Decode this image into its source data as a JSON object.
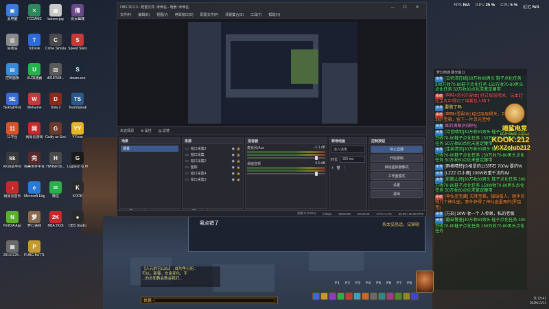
{
  "top_stats": {
    "fps_label": "FPS",
    "fps_value": "N/A",
    "gpu_label": "GPU",
    "gpu_value": "25 %",
    "cpu_label": "CPU",
    "cpu_value": "5 %",
    "latency_label": "延迟",
    "latency_value": "N/A"
  },
  "desktop_icons": [
    {
      "label": "此电脑",
      "glyph": "▣",
      "color": "#3a7bd5"
    },
    {
      "label": "TCGAME",
      "glyph": "✕",
      "color": "#2c8a5a"
    },
    {
      "label": "banner.jpg",
      "glyph": "▦",
      "color": "#c9c9c9"
    },
    {
      "label": "倩女幽魂",
      "glyph": "倩",
      "color": "#6a4a8a"
    },
    {
      "label": "回收站",
      "glyph": "▥",
      "color": "#8a8a8a"
    },
    {
      "label": "ToDesk",
      "glyph": "T",
      "color": "#2b6ad8"
    },
    {
      "label": "Crime Simulator",
      "glyph": "C",
      "color": "#4a4a4a"
    },
    {
      "label": "Speed Stars",
      "glyph": "S",
      "color": "#c43a3a"
    },
    {
      "label": "控制面板",
      "glyph": "▤",
      "color": "#3a8ad5"
    },
    {
      "label": "UU加速器",
      "glyph": "U",
      "color": "#2ab04a"
    },
    {
      "label": "d0187b9f...",
      "glyph": "▧",
      "color": "#5a5a5a"
    },
    {
      "label": "steam.exe",
      "glyph": "S",
      "color": "#1b2838"
    },
    {
      "label": "5E对战平台",
      "glyph": "5E",
      "color": "#3a6ad5"
    },
    {
      "label": "WeGame",
      "glyph": "W",
      "color": "#c43a3a"
    },
    {
      "label": "Dota 2",
      "glyph": "D",
      "color": "#8a2a1a"
    },
    {
      "label": "TeamSpeak",
      "glyph": "TS",
      "color": "#2a5a8a"
    },
    {
      "label": "11平台",
      "glyph": "11",
      "color": "#d5552a"
    },
    {
      "label": "网易云游戏",
      "glyph": "网",
      "color": "#c42a2a"
    },
    {
      "label": "Guilty as Sock!",
      "glyph": "G",
      "color": "#6a3a2a"
    },
    {
      "label": "YY.exe",
      "glyph": "YY",
      "color": "#e8b42a"
    },
    {
      "label": "KK对战平台",
      "glyph": "kk",
      "color": "#3a3a3a"
    },
    {
      "label": "完美世界平台",
      "glyph": "完",
      "color": "#5a2a2a"
    },
    {
      "label": "HWINFO6...",
      "glyph": "H",
      "color": "#4a4a4a"
    },
    {
      "label": "Logitech G HUB",
      "glyph": "G",
      "color": "#1a1a1a"
    },
    {
      "label": "网易云音乐",
      "glyph": "♪",
      "color": "#c42a2a"
    },
    {
      "label": "Microsoft Edge",
      "glyph": "e",
      "color": "#2a7ad5"
    },
    {
      "label": "微信",
      "glyph": "✉",
      "color": "#2ab04a"
    },
    {
      "label": "KOOK",
      "glyph": "K",
      "color": "#2a2a2a"
    },
    {
      "label": "NVIDIA App",
      "glyph": "N",
      "color": "#5ab02a"
    },
    {
      "label": "萝心语网",
      "glyph": "萝",
      "color": "#8a6a4a"
    },
    {
      "label": "NBA 2K26",
      "glyph": "2K",
      "color": "#c42a2a"
    },
    {
      "label": "OBS Studio",
      "glyph": "●",
      "color": "#2a2a2a"
    },
    {
      "label": "20141225...",
      "glyph": "▦",
      "color": "#6a6a6a"
    },
    {
      "label": "PUBG BATTLEGR...",
      "glyph": "P",
      "color": "#c49a2a"
    }
  ],
  "obs": {
    "title": "OBS 30.2.3 - 配置文件: 未命名 - 场景: 未命名",
    "menu": [
      "文件(F)",
      "编辑(E)",
      "视图(V)",
      "停靠窗口(D)",
      "配置文件(P)",
      "场景集合(S)",
      "工具(T)",
      "帮助(H)"
    ],
    "source_bar": {
      "no_source": "未选择源",
      "properties": "属性",
      "filters": "滤镜"
    },
    "scenes_title": "场景",
    "scene_item": "场景",
    "sources_title": "来源",
    "sources": [
      "窗口采集2",
      "窗口采集",
      "窗口采集2",
      "图像",
      "窗口采集4",
      "窗口采集3"
    ],
    "mixer_title": "混音器",
    "mixer_channels": [
      {
        "name": "麦克风/Aux",
        "level": "-1.1 dB"
      },
      {
        "name": "桌面音频",
        "level": "0.0 dB"
      }
    ],
    "transitions_title": "转场动画",
    "transition_type": "淡入淡出",
    "duration_label": "时长",
    "duration_value": "300 ms",
    "controls_title": "控制按钮",
    "controls": [
      "停止直播",
      "开始录制",
      "启动虚拟摄像机",
      "工作室模式",
      "设置",
      "退出"
    ],
    "status": {
      "dropped": "丢帧 0 (0.0%)",
      "bitrate": "0 kbps",
      "live_time": "00:00:00",
      "rec_time": "00:00:00",
      "cpu": "CPU: 0.4%",
      "fps": "60.00 / 60.00 FPS"
    }
  },
  "game": {
    "dialog_msg": "我点错了",
    "dialog_msg2": "系太交恐话，试探吸",
    "chat_lines": [
      "【人元的召山Zz】: 成功争分用..",
      "可以，新春，东金变化，不",
      "...的总和教会教会我们..."
    ],
    "hotkeys": [
      "F1",
      "F2",
      "F3",
      "F4",
      "F5",
      "F6",
      "F7",
      "F8"
    ],
    "input_channel": "世界"
  },
  "chat_panel": {
    "title": "梦幻西游 聊天窗口",
    "lines": [
      {
        "tag": "世界",
        "tagc": "",
        "cls": "g",
        "text": "[云师湾在线]30万收80男头 鞋子点化任务 300万收70-80鞋子点化任务 150万收70-80男头点化任务 50万收60点化未鉴定腰带"
      },
      {
        "tag": "系统",
        "tagc": "red",
        "cls": "r",
        "text": "[啊呀#恶劣的副本] 经过层层揭关，玩本起在宝库中得到了锦囊包人箱下"
      },
      {
        "tag": "世界",
        "tagc": "",
        "cls": "y",
        "text": "要做了吗"
      },
      {
        "tag": "系统",
        "tagc": "red",
        "cls": "o",
        "text": "[啊呀#雪副本] 经过层层揭关，到了这里遇到的宝箱，留下一片灵光宝物"
      },
      {
        "tag": "世界",
        "tagc": "",
        "cls": "p",
        "text": "果的满眼[吗满吗]"
      },
      {
        "tag": "世界",
        "tagc": "",
        "cls": "g",
        "text": "[诗音晴明]30万收80男头 鞋子点化任务 300万收70-80鞋子点化任务 150万收70-80男头点化任务 50万收60点化未鉴定腰带"
      },
      {
        "tag": "世界",
        "tagc": "",
        "cls": "g",
        "text": "[佳弟清流]30万收80男头 鞋子点化任务 300万收70-80鞋子点化任务 150万收70-80男头点化任务 50万收60点化未鉴定腰带"
      },
      {
        "tag": "世界",
        "tagc": "",
        "cls": "w",
        "text": "[雨格晴转]价格是的115环石 700W 要的W"
      },
      {
        "tag": "世界",
        "tagc": "",
        "cls": "w",
        "text": "[LZZZ 红小鹿] 200W收重千法的IM"
      },
      {
        "tag": "世界",
        "tagc": "",
        "cls": "g",
        "text": "[影鹏山师]30万收80男头 鞋子点化任务 300万收70-80鞋子点化任务 150W收70-80男头点化任务 50万收60点化未鉴定腰带"
      },
      {
        "tag": "系统",
        "tagc": "red",
        "cls": "o",
        "text": "[神仙壶宝藏] 天降宝箱，福瑞临人，随手捡得几个神仙壶，意外获得了神仙壶里面的[罗盘宝]"
      },
      {
        "tag": "世界",
        "tagc": "",
        "cls": "w",
        "text": "[万奈] 20W 收一个 人参果，私的老板"
      },
      {
        "tag": "世界",
        "tagc": "",
        "cls": "g",
        "text": "[蘑菇警查]30万收80男头 鞋子点化任务 300万收70-80鞋子点化任务 150万收70-80男头点化任务"
      }
    ]
  },
  "sticker": {
    "brand": "喵鲨电竞",
    "sub": "MIAO SHARK GAMING",
    "kook": "KOOK:212",
    "vx": "V:XZclub212"
  },
  "tray": {
    "time": "11:23:41",
    "date": "2025/11/11"
  }
}
